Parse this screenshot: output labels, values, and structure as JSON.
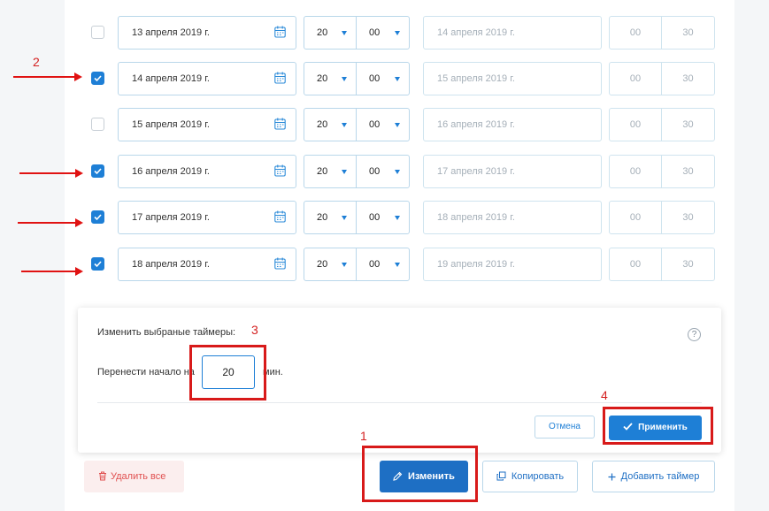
{
  "rows": [
    {
      "checked": false,
      "date": "13 апреля 2019 г.",
      "hour": "20",
      "minute": "00",
      "end": "14 апреля 2019 г.",
      "dur_h": "00",
      "dur_m": "30"
    },
    {
      "checked": true,
      "date": "14 апреля 2019 г.",
      "hour": "20",
      "minute": "00",
      "end": "15 апреля 2019 г.",
      "dur_h": "00",
      "dur_m": "30"
    },
    {
      "checked": false,
      "date": "15 апреля 2019 г.",
      "hour": "20",
      "minute": "00",
      "end": "16 апреля 2019 г.",
      "dur_h": "00",
      "dur_m": "30"
    },
    {
      "checked": true,
      "date": "16 апреля 2019 г.",
      "hour": "20",
      "minute": "00",
      "end": "17 апреля 2019 г.",
      "dur_h": "00",
      "dur_m": "30"
    },
    {
      "checked": true,
      "date": "17 апреля 2019 г.",
      "hour": "20",
      "minute": "00",
      "end": "18 апреля 2019 г.",
      "dur_h": "00",
      "dur_m": "30"
    },
    {
      "checked": true,
      "date": "18 апреля 2019 г.",
      "hour": "20",
      "minute": "00",
      "end": "19 апреля 2019 г.",
      "dur_h": "00",
      "dur_m": "30"
    }
  ],
  "annotations": {
    "n1": "1",
    "n2": "2",
    "n3": "3",
    "n4": "4"
  },
  "popup": {
    "title": "Изменить выбраные таймеры:",
    "help": "?",
    "shift_label": "Перенести начало на",
    "shift_value": "20",
    "shift_unit": "мин.",
    "cancel": "Отмена",
    "apply": "Применить"
  },
  "footer": {
    "delete_all": "Удалить все",
    "edit": "Изменить",
    "copy": "Копировать",
    "add_timer": "Добавить таймер"
  },
  "colors": {
    "accent": "#1e7fd6",
    "annotation": "#d81a1a",
    "danger": "#e05050"
  }
}
